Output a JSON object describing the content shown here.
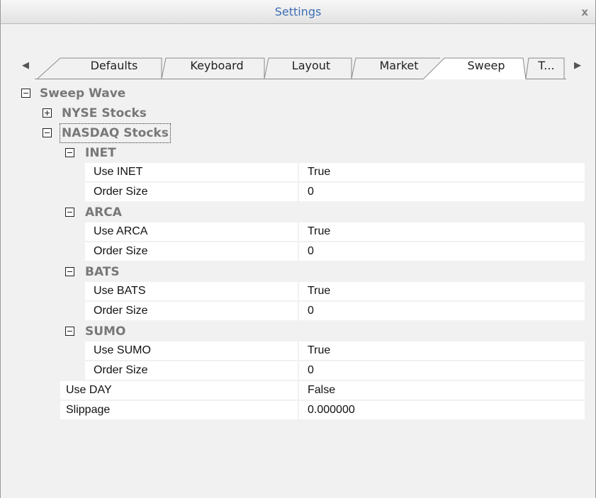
{
  "window": {
    "title": "Settings",
    "close_glyph": "x"
  },
  "tabs": {
    "scroll_left_glyph": "◀",
    "scroll_right_glyph": "▶",
    "items": [
      {
        "label": "Defaults",
        "active": false
      },
      {
        "label": "Keyboard",
        "active": false
      },
      {
        "label": "Layout",
        "active": false
      },
      {
        "label": "Market",
        "active": false
      },
      {
        "label": "Sweep",
        "active": true
      },
      {
        "label": "T...",
        "active": false
      }
    ]
  },
  "grid": {
    "root": {
      "label": "Sweep Wave",
      "expanded": true
    },
    "nyse": {
      "label": "NYSE Stocks",
      "expanded": false
    },
    "nasdaq": {
      "label": "NASDAQ Stocks",
      "expanded": true
    },
    "inet": {
      "label": "INET",
      "props": [
        {
          "name": "Use INET",
          "value": "True"
        },
        {
          "name": "Order Size",
          "value": "0"
        }
      ]
    },
    "arca": {
      "label": "ARCA",
      "props": [
        {
          "name": "Use ARCA",
          "value": "True"
        },
        {
          "name": "Order Size",
          "value": "0"
        }
      ]
    },
    "bats": {
      "label": "BATS",
      "props": [
        {
          "name": "Use BATS",
          "value": "True"
        },
        {
          "name": "Order Size",
          "value": "0"
        }
      ]
    },
    "sumo": {
      "label": "SUMO",
      "props": [
        {
          "name": "Use SUMO",
          "value": "True"
        },
        {
          "name": "Order Size",
          "value": "0"
        }
      ]
    },
    "use_day": {
      "name": "Use DAY",
      "value": "False"
    },
    "slippage": {
      "name": "Slippage",
      "value": "0.000000"
    }
  }
}
